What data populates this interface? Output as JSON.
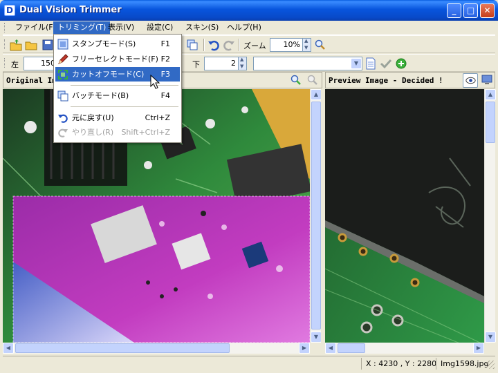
{
  "window": {
    "title": "Dual Vision Trimmer",
    "icon_letter": "D",
    "min": "_",
    "max": "□",
    "close": "✕"
  },
  "menubar": {
    "items": [
      {
        "label": "ファイル(F)"
      },
      {
        "label": "トリミング(T)"
      },
      {
        "label": "表示(V)"
      },
      {
        "label": "設定(C)"
      },
      {
        "label": "スキン(S)"
      },
      {
        "label": "ヘルプ(H)"
      }
    ]
  },
  "toolbar1": {
    "zoom_label": "ズーム",
    "zoom_value": "10%"
  },
  "toolbar2": {
    "left_label": "左",
    "left_value": "150",
    "bottom_label": "下",
    "bottom_value": "2",
    "combo_value": ""
  },
  "trim_menu": {
    "items": [
      {
        "label": "スタンプモード(S)",
        "shortcut": "F1"
      },
      {
        "label": "フリーセレクトモード(F)",
        "shortcut": "F2"
      },
      {
        "label": "カットオフモード(C)",
        "shortcut": "F3"
      },
      {
        "label": "バッチモード(B)",
        "shortcut": "F4"
      },
      {
        "label": "元に戻す(U)",
        "shortcut": "Ctrl+Z"
      },
      {
        "label": "やり直し(R)",
        "shortcut": "Shift+Ctrl+Z"
      }
    ]
  },
  "left_pane": {
    "title": "Original Ima"
  },
  "right_pane": {
    "title": "Preview Image - Decided !"
  },
  "status": {
    "coords": "X : 4230 , Y : 2280",
    "filename": "Img1598.jpg"
  },
  "colors": {
    "title_blue": "#0855DD",
    "highlight": "#316AC5",
    "pcb_green": "#2F8A3C",
    "pcb_magenta": "#C23CC0"
  }
}
